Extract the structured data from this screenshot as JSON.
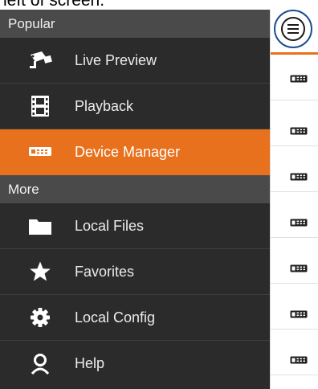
{
  "caption_text": "left of screen.",
  "colors": {
    "accent": "#e8711e",
    "drawer_bg": "#2b2b2b",
    "section_bg": "#4a4a4a",
    "menu_ring": "#1d4f91"
  },
  "drawer": {
    "sections": [
      {
        "title": "Popular",
        "items": [
          {
            "label": "Live Preview",
            "icon": "camera-icon",
            "active": false
          },
          {
            "label": "Playback",
            "icon": "film-icon",
            "active": false
          },
          {
            "label": "Device Manager",
            "icon": "dvr-icon",
            "active": true
          }
        ]
      },
      {
        "title": "More",
        "items": [
          {
            "label": "Local Files",
            "icon": "folder-icon",
            "active": false
          },
          {
            "label": "Favorites",
            "icon": "star-icon",
            "active": false
          },
          {
            "label": "Local Config",
            "icon": "gear-icon",
            "active": false
          },
          {
            "label": "Help",
            "icon": "person-icon",
            "active": false
          }
        ]
      }
    ]
  },
  "right_panel": {
    "menu_icon": "hamburger-menu-icon",
    "device_row_icon": "dvr-icon",
    "device_row_count": 7
  }
}
